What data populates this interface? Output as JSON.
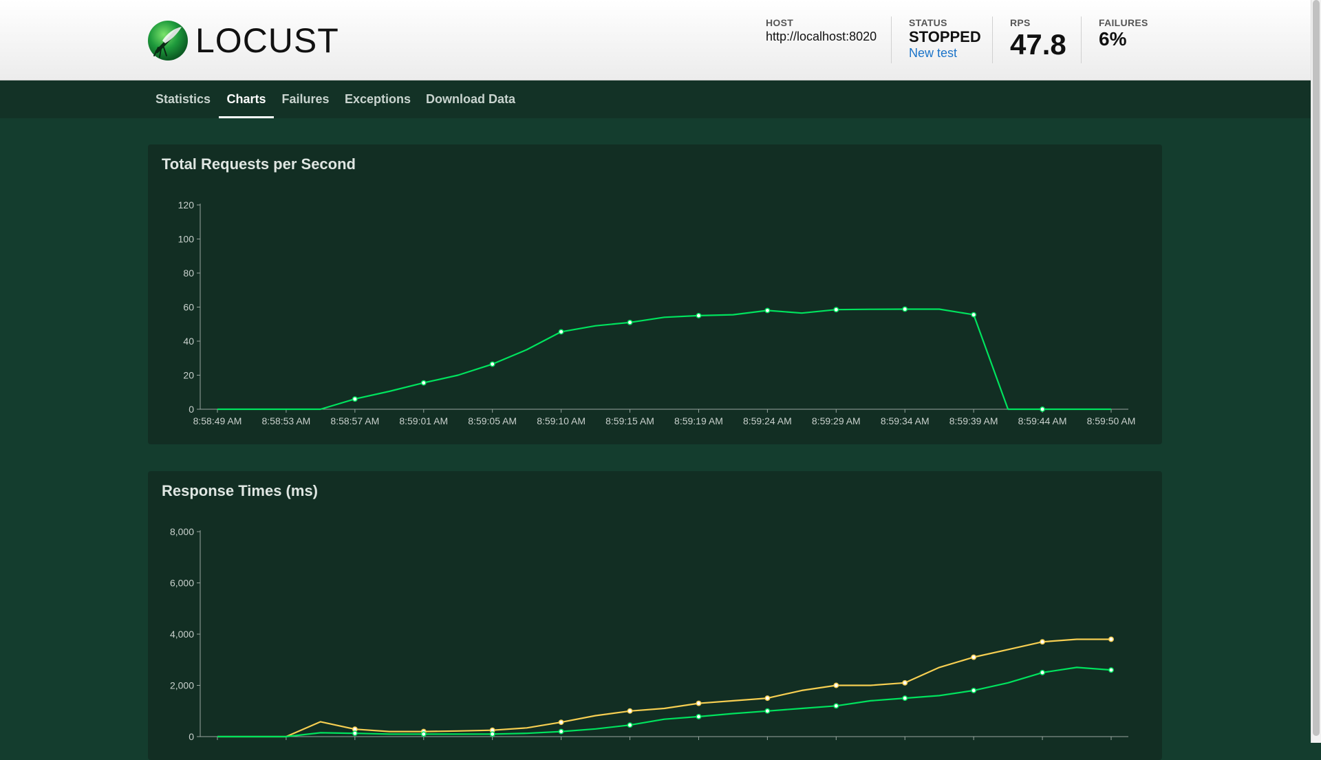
{
  "brand": {
    "name": "LOCUST"
  },
  "header": {
    "host_label": "HOST",
    "host_value": "http://localhost:8020",
    "status_label": "STATUS",
    "status_value": "STOPPED",
    "new_test_label": "New test",
    "rps_label": "RPS",
    "rps_value": "47.8",
    "failures_label": "FAILURES",
    "failures_value": "6%"
  },
  "nav": {
    "tabs": [
      {
        "label": "Statistics",
        "active": false
      },
      {
        "label": "Charts",
        "active": true
      },
      {
        "label": "Failures",
        "active": false
      },
      {
        "label": "Exceptions",
        "active": false
      },
      {
        "label": "Download Data",
        "active": false
      }
    ]
  },
  "colors": {
    "page_bg": "#143d2e",
    "card_bg": "#122e23",
    "series_green": "#00e35e",
    "series_yellow": "#f7cf52",
    "link": "#1a73c8"
  },
  "chart_data": [
    {
      "type": "line",
      "title": "Total Requests per Second",
      "x_tick_labels": [
        "8:58:49 AM",
        "8:58:53 AM",
        "8:58:57 AM",
        "8:59:01 AM",
        "8:59:05 AM",
        "8:59:10 AM",
        "8:59:15 AM",
        "8:59:19 AM",
        "8:59:24 AM",
        "8:59:29 AM",
        "8:59:34 AM",
        "8:59:39 AM",
        "8:59:44 AM",
        "8:59:50 AM"
      ],
      "y_ticks": [
        0,
        20,
        40,
        60,
        80,
        100,
        120
      ],
      "ylim": [
        0,
        120
      ],
      "grid": false,
      "series": [
        {
          "color": "#00e35e",
          "values": [
            0,
            0,
            0,
            0,
            6,
            10.5,
            15.5,
            20,
            26.5,
            35,
            45.5,
            49,
            51,
            54,
            55,
            55.5,
            58,
            56.5,
            58.5,
            58.7,
            58.8,
            58.8,
            55.5,
            0,
            0,
            0,
            0
          ],
          "markers": [
            4,
            6,
            8,
            10,
            12,
            14,
            16,
            18,
            20,
            22,
            24
          ]
        }
      ]
    },
    {
      "type": "line",
      "title": "Response Times (ms)",
      "y_ticks": [
        0,
        2000,
        4000,
        6000,
        8000
      ],
      "y_tick_labels": [
        "0",
        "2,000",
        "4,000",
        "6,000",
        "8,000"
      ],
      "ylim": [
        0,
        8000
      ],
      "grid": false,
      "series": [
        {
          "color": "#f7cf52",
          "values": [
            0,
            0,
            0,
            580,
            290,
            200,
            200,
            220,
            250,
            340,
            560,
            820,
            1000,
            1100,
            1300,
            1400,
            1500,
            1800,
            2000,
            2000,
            2100,
            2700,
            3100,
            3400,
            3700,
            3800,
            3800
          ],
          "markers": [
            4,
            6,
            8,
            10,
            12,
            14,
            16,
            18,
            20,
            22,
            24,
            26
          ]
        },
        {
          "color": "#00e35e",
          "values": [
            0,
            0,
            0,
            150,
            130,
            100,
            100,
            100,
            100,
            130,
            200,
            300,
            450,
            680,
            780,
            900,
            1000,
            1100,
            1200,
            1400,
            1500,
            1600,
            1800,
            2100,
            2500,
            2700,
            2600
          ],
          "markers": [
            4,
            6,
            8,
            10,
            12,
            14,
            16,
            18,
            20,
            22,
            24,
            26
          ]
        }
      ]
    }
  ]
}
